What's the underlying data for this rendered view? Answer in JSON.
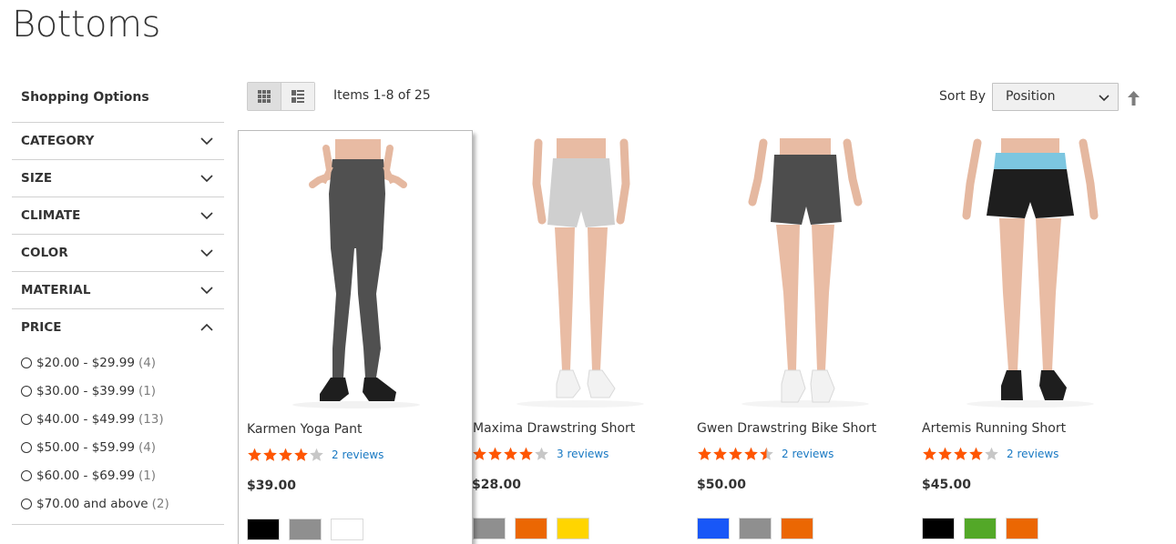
{
  "page": {
    "title": "Bottoms"
  },
  "sidebar": {
    "title": "Shopping Options",
    "filters": [
      {
        "label": "CATEGORY"
      },
      {
        "label": "SIZE"
      },
      {
        "label": "CLIMATE"
      },
      {
        "label": "COLOR"
      },
      {
        "label": "MATERIAL"
      }
    ],
    "price": {
      "label": "PRICE",
      "options": [
        {
          "label": "$20.00 - $29.99",
          "count": "(4)"
        },
        {
          "label": "$30.00 - $39.99",
          "count": "(1)"
        },
        {
          "label": "$40.00 - $49.99",
          "count": "(13)"
        },
        {
          "label": "$50.00 - $59.99",
          "count": "(4)"
        },
        {
          "label": "$60.00 - $69.99",
          "count": "(1)"
        },
        {
          "label": "$70.00 and above",
          "count": "(2)"
        }
      ]
    }
  },
  "toolbar": {
    "items_count": "Items 1-8 of 25",
    "sort_label": "Sort By",
    "sort_value": "Position",
    "icons": [
      "grid-view-icon",
      "list-view-icon",
      "chevron-down-icon",
      "sort-arrow-up-icon"
    ]
  },
  "products": [
    {
      "name": "Karmen Yoga Pant",
      "rating_stars": 4,
      "reviews": "2 reviews",
      "price": "$39.00",
      "swatches": [
        "#000000",
        "#8f8f8f",
        "#ffffff"
      ]
    },
    {
      "name": "Maxima Drawstring Short",
      "rating_stars": 4,
      "reviews": "3 reviews",
      "price": "$28.00",
      "swatches": [
        "#8f8f8f",
        "#eb6703",
        "#ffd500"
      ]
    },
    {
      "name": "Gwen Drawstring Bike Short",
      "rating_stars": 4.5,
      "reviews": "2 reviews",
      "price": "$50.00",
      "swatches": [
        "#1857f7",
        "#8f8f8f",
        "#eb6703"
      ]
    },
    {
      "name": "Artemis Running Short",
      "rating_stars": 4,
      "reviews": "2 reviews",
      "price": "$45.00",
      "swatches": [
        "#000000",
        "#53a828",
        "#eb6703"
      ]
    }
  ],
  "colors": {
    "link": "#1979c3",
    "star": "#ff5501",
    "star_empty": "#c7c7c7"
  }
}
